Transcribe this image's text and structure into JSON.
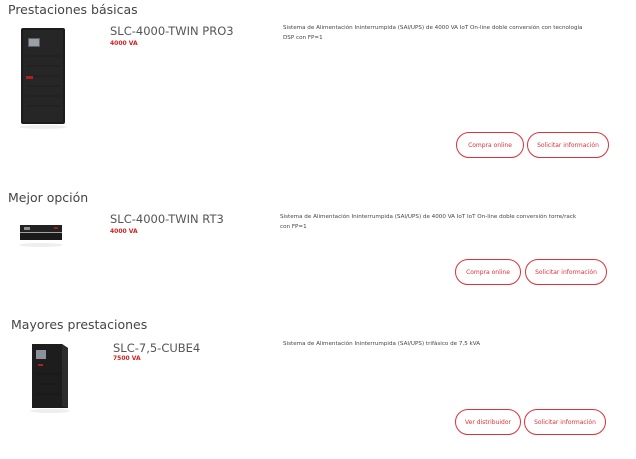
{
  "sections": [
    {
      "heading": "Prestaciones básicas",
      "model": "SLC-4000-TWIN PRO3",
      "power": "4000 VA",
      "description": "Sistema de Alimentación Ininterrumpida (SAI/UPS) de 4000 VA IoT On-line doble conversión con tecnología DSP con FP=1",
      "buttons": [
        "Compra online",
        "Solicitar información"
      ]
    },
    {
      "heading": "Mejor opción",
      "model": "SLC-4000-TWIN RT3",
      "power": "4000 VA",
      "description": "Sistema de Alimentación Ininterrumpida (SAI/UPS) de 4000 VA IoT IoT On-line doble conversión torre/rack con FP=1",
      "buttons": [
        "Compra online",
        "Solicitar información"
      ]
    },
    {
      "heading": "Mayores prestaciones",
      "model": "SLC-7,5-CUBE4",
      "power": "7500 VA",
      "description": "Sistema de Alimentación Ininterrumpida (SAI/UPS) trifásico de 7,5 kVA",
      "buttons": [
        "Ver distribuidor",
        "Solicitar información"
      ]
    }
  ],
  "colors": {
    "accent": "#e0303a",
    "power": "#d11f1f"
  }
}
